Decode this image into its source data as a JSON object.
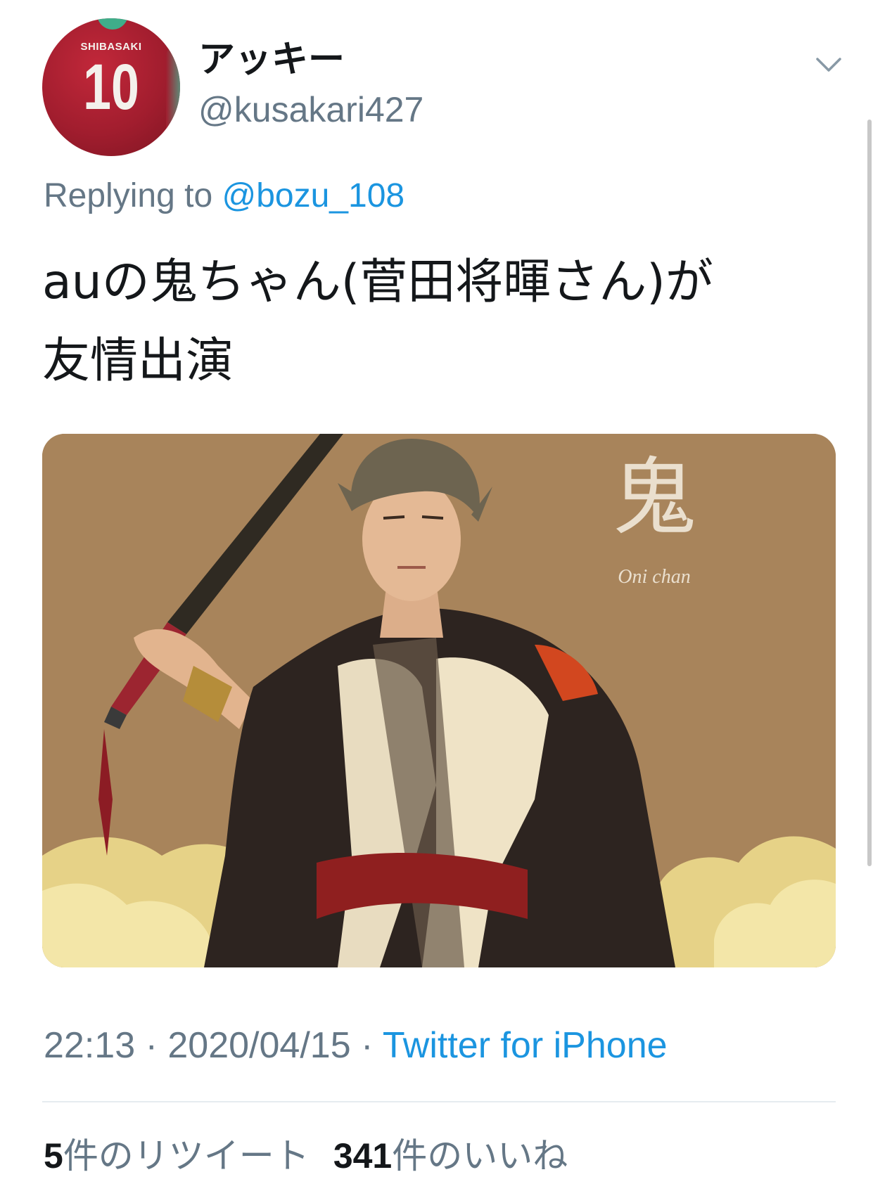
{
  "author": {
    "display_name": "アッキー",
    "handle": "@kusakari427",
    "avatar": {
      "jersey_name": "SHIBASAKI",
      "jersey_number": "10",
      "jersey_color": "#a11d2e"
    }
  },
  "reply": {
    "prefix": "Replying to",
    "mention": "@bozu_108"
  },
  "tweet": {
    "text": "auの鬼ちゃん(菅田将暉さん)が\n友情出演"
  },
  "media": {
    "kanji": "鬼",
    "caption": "Oni chan",
    "background_color": "#a8845b"
  },
  "meta": {
    "time": "22:13",
    "separator": " · ",
    "date": "2020/04/15",
    "source": "Twitter for iPhone"
  },
  "stats": {
    "retweet_count": "5",
    "retweet_label": "件のリツイート",
    "like_count": "341",
    "like_label": "件のいいね"
  },
  "icons": {
    "menu": "chevron-down-icon"
  },
  "colors": {
    "link": "#1b95e0",
    "secondary_text": "#657786",
    "primary_text": "#14171a",
    "divider": "#e6ecf0"
  }
}
